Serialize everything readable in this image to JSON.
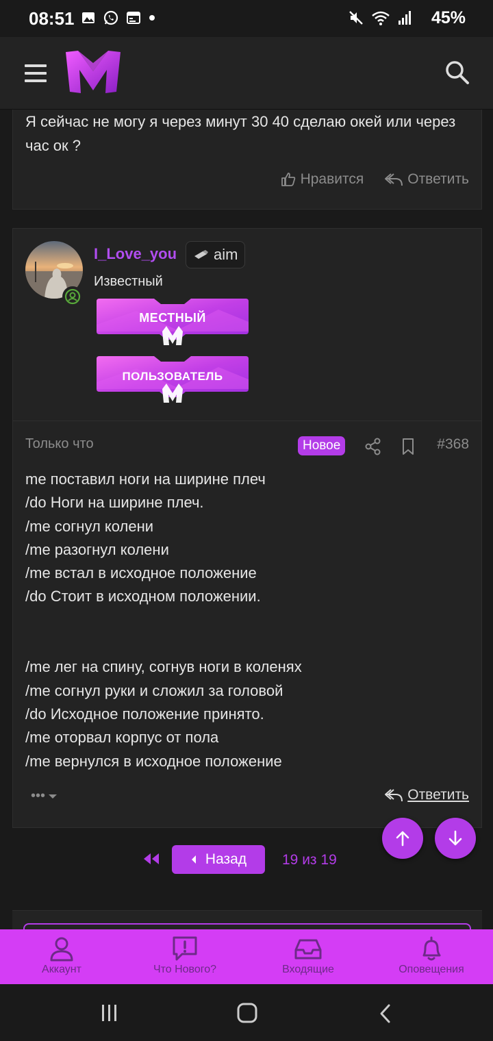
{
  "status_bar": {
    "time": "08:51",
    "battery": "45%"
  },
  "header": {
    "menu_icon": "hamburger-icon",
    "logo_letter": "M",
    "search_icon": "search-icon"
  },
  "previous_post": {
    "text": "Я сейчас не могу я через минут 30 40 сделаю окей или через час ок ?",
    "like_label": "Нравится",
    "reply_label": "Ответить"
  },
  "author": {
    "username": "I_Love_you",
    "tag": "aim",
    "title": "Известный",
    "banners": [
      "МЕСТНЫЙ",
      "ПОЛЬЗОВАТЕЛЬ"
    ]
  },
  "post": {
    "time": "Только что",
    "badge": "Новое",
    "number": "#368",
    "lines": [
      "me поставил ноги на ширине плеч",
      "/do Ноги на ширине плеч.",
      "/me согнул колени",
      "/me разогнул колени",
      "/me встал в исходное положение",
      "/do Стоит в исходном положении.",
      "",
      "",
      "/me лег на спину, согнув ноги в коленях",
      "/me согнул руки и сложил за головой",
      "/do Исходное положение принято.",
      "/me оторвал корпус от пола",
      "/me вернулся в исходное положение"
    ],
    "more_label": "•••",
    "reply_label": "Ответить"
  },
  "pagination": {
    "back_label": "Назад",
    "count": "19 из 19"
  },
  "tabbar": {
    "tabs": [
      {
        "label": "Аккаунт",
        "icon": "user-icon"
      },
      {
        "label": "Что Нового?",
        "icon": "alert-bubble-icon"
      },
      {
        "label": "Входящие",
        "icon": "inbox-icon"
      },
      {
        "label": "Оповещения",
        "icon": "bell-icon"
      }
    ]
  },
  "colors": {
    "accent": "#b33ce8",
    "tabbar": "#d43df5",
    "background": "#1a1a1a",
    "card": "#232323"
  }
}
